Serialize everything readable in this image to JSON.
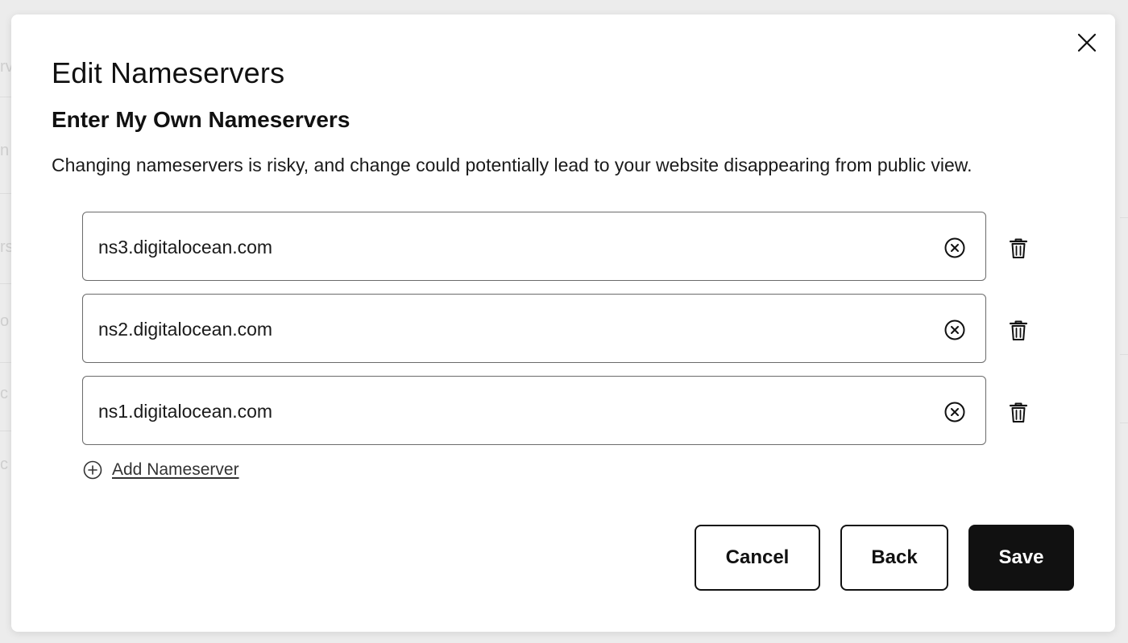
{
  "modal": {
    "title": "Edit Nameservers",
    "subtitle": "Enter My Own Nameservers",
    "description": "Changing nameservers is risky, and change could potentially lead to your website disappearing from public view.",
    "close_icon": "close-icon"
  },
  "nameservers": [
    {
      "value": "ns3.digitalocean.com",
      "clear_icon": "clear-circle-x-icon",
      "delete_icon": "trash-icon"
    },
    {
      "value": "ns2.digitalocean.com",
      "clear_icon": "clear-circle-x-icon",
      "delete_icon": "trash-icon"
    },
    {
      "value": "ns1.digitalocean.com",
      "clear_icon": "clear-circle-x-icon",
      "delete_icon": "trash-icon"
    }
  ],
  "add_nameserver": {
    "label": "Add Nameserver",
    "icon": "plus-circle-icon"
  },
  "actions": {
    "cancel_label": "Cancel",
    "back_label": "Back",
    "save_label": "Save"
  },
  "colors": {
    "primary": "#111111",
    "border": "#6b6b6b",
    "backdrop": "#ececec",
    "surface": "#ffffff"
  }
}
